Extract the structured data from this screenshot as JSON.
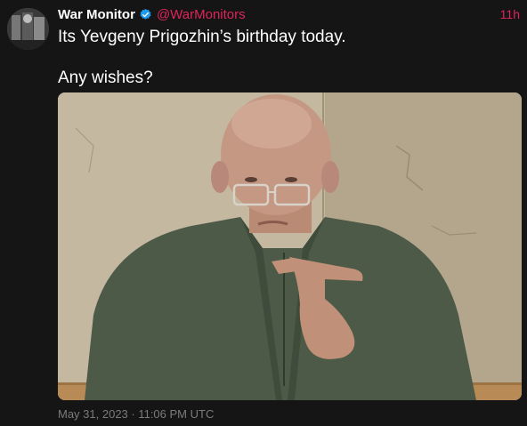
{
  "author": {
    "display_name": "War Monitor",
    "handle": "@WarMonitors",
    "verified": true,
    "avatar_icon": "avatar-image"
  },
  "post": {
    "relative_time": "11h",
    "text_line1": "Its Yevgeny Prigozhin’s birthday today.",
    "text_line2": "Any wishes?",
    "timestamp": "May 31, 2023 · 11:06 PM UTC"
  },
  "media": {
    "type": "photo",
    "description_icon": "photo"
  },
  "colors": {
    "background": "#151515",
    "text": "#ffffff",
    "accent": "#e0245e",
    "muted": "#7b7b7b",
    "verified": "#1d9bf0"
  }
}
